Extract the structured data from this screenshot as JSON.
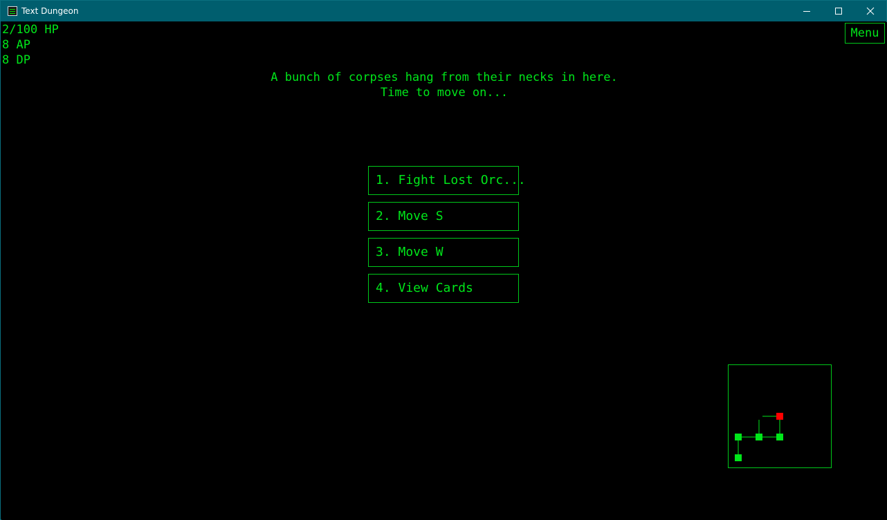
{
  "window": {
    "title": "Text Dungeon",
    "icon": "terminal-app-icon"
  },
  "stats": {
    "hp": "2/100 HP",
    "ap": "8 AP",
    "dp": "8 DP"
  },
  "menu_label": "Menu",
  "description": {
    "line1": "A bunch of corpses hang from their necks in here.",
    "line2": "Time to move on..."
  },
  "actions": [
    {
      "label": "1. Fight Lost Orc..."
    },
    {
      "label": "2. Move S"
    },
    {
      "label": "3. Move W"
    },
    {
      "label": "4. View Cards"
    }
  ],
  "minimap": {
    "visited_color": "#00e61a",
    "current_color": "#ff0000",
    "line_color": "#00e61a"
  }
}
